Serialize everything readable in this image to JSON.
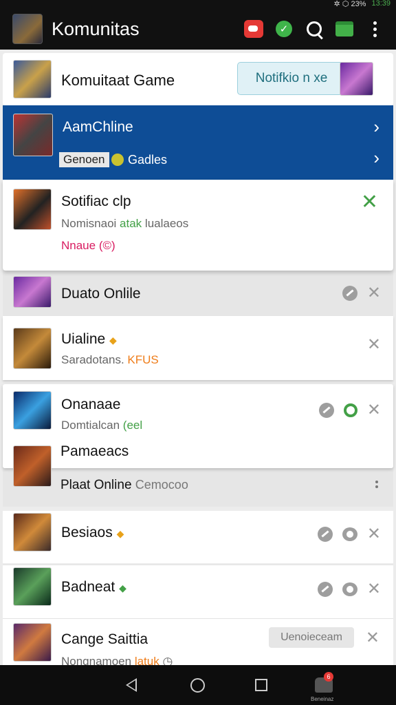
{
  "status_bar": {
    "icons": "✲ ⬡ 23%",
    "battery": "13:39"
  },
  "app_bar": {
    "title": "Komunitas"
  },
  "header_card": {
    "title": "Komuitaat Game",
    "notif_button": "Notifkio n xe"
  },
  "selected_card": {
    "title": "AamChline",
    "tag": "Genoen",
    "sub": "Gadles"
  },
  "expanded_card": {
    "title": "Sotifiac clp",
    "line1_a": "Nomisnaoi",
    "line1_b": "atak",
    "line1_c": "lualaeos",
    "line2": "Nnaue (©)"
  },
  "rows": [
    {
      "name": "Duato Onlile"
    },
    {
      "name": "Uialine",
      "badge": "◆",
      "sub_a": "Saradotans.",
      "sub_b": "KFUS"
    },
    {
      "name": "Onanaae",
      "sub_a": "Domtialcan",
      "sub_b": "(eel"
    },
    {
      "name": "Pamaeacs"
    },
    {
      "name": "Plaat Online",
      "sub": "Cemocoo"
    },
    {
      "name": "Besiaos",
      "badge": "◆"
    },
    {
      "name": "Badneat",
      "badge": "◆"
    },
    {
      "name": "Cange Saittia",
      "button": "Uenoieceam",
      "sub_a": "Nongnamoen",
      "sub_b": "latuk",
      "sub_c": "◷"
    }
  ],
  "nav_bar": {
    "profile_badge": "6",
    "profile_label": "Beneinaz"
  }
}
